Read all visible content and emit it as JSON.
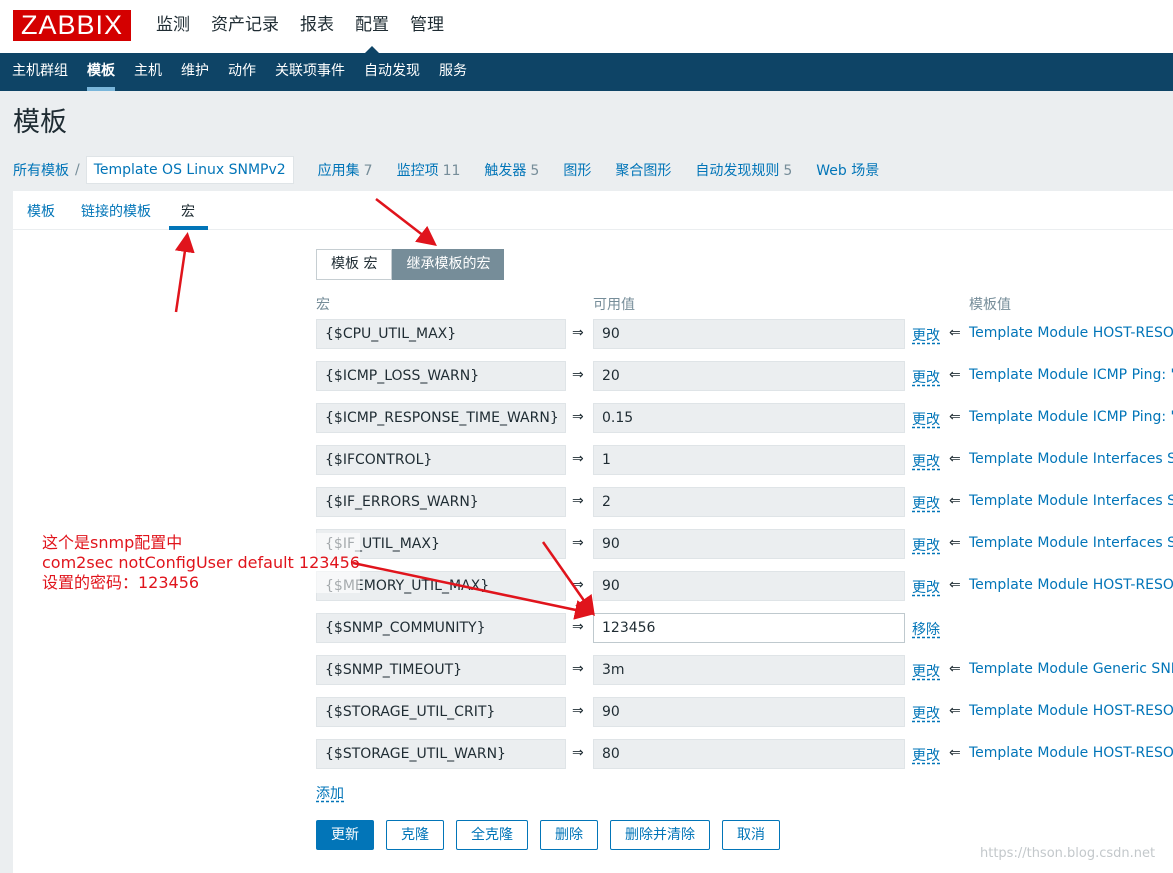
{
  "logo": "ZABBIX",
  "top_nav": [
    {
      "label": "监测",
      "active": false
    },
    {
      "label": "资产记录",
      "active": false
    },
    {
      "label": "报表",
      "active": false
    },
    {
      "label": "配置",
      "active": true
    },
    {
      "label": "管理",
      "active": false
    }
  ],
  "sub_nav": [
    {
      "label": "主机群组",
      "active": false
    },
    {
      "label": "模板",
      "active": true
    },
    {
      "label": "主机",
      "active": false
    },
    {
      "label": "维护",
      "active": false
    },
    {
      "label": "动作",
      "active": false
    },
    {
      "label": "关联项事件",
      "active": false
    },
    {
      "label": "自动发现",
      "active": false
    },
    {
      "label": "服务",
      "active": false
    }
  ],
  "page_title": "模板",
  "breadcrumb": {
    "all": "所有模板",
    "sep": "/",
    "current": "Template OS Linux SNMPv2",
    "links": [
      {
        "label": "应用集",
        "count": "7"
      },
      {
        "label": "监控项",
        "count": "11"
      },
      {
        "label": "触发器",
        "count": "5"
      },
      {
        "label": "图形",
        "count": ""
      },
      {
        "label": "聚合图形",
        "count": ""
      },
      {
        "label": "自动发现规则",
        "count": "5"
      },
      {
        "label": "Web 场景",
        "count": ""
      }
    ]
  },
  "tabs": [
    "模板",
    "链接的模板",
    "宏"
  ],
  "segment": {
    "template_macros": "模板 宏",
    "inherited_macros": "继承模板的宏"
  },
  "headers": {
    "macro": "宏",
    "effective_value": "可用值",
    "template_value": "模板值"
  },
  "rows": [
    {
      "macro": "{$CPU_UTIL_MAX}",
      "value": "90",
      "action": "更改",
      "template": "Template Module HOST-RESO"
    },
    {
      "macro": "{$ICMP_LOSS_WARN}",
      "value": "20",
      "action": "更改",
      "template": "Template Module ICMP Ping: \""
    },
    {
      "macro": "{$ICMP_RESPONSE_TIME_WARN}",
      "value": "0.15",
      "action": "更改",
      "template": "Template Module ICMP Ping: \""
    },
    {
      "macro": "{$IFCONTROL}",
      "value": "1",
      "action": "更改",
      "template": "Template Module Interfaces SN"
    },
    {
      "macro": "{$IF_ERRORS_WARN}",
      "value": "2",
      "action": "更改",
      "template": "Template Module Interfaces SN"
    },
    {
      "macro": "{$IF_UTIL_MAX}",
      "value": "90",
      "action": "更改",
      "template": "Template Module Interfaces SN"
    },
    {
      "macro": "{$MEMORY_UTIL_MAX}",
      "value": "90",
      "action": "更改",
      "template": "Template Module HOST-RESO"
    },
    {
      "macro": "{$SNMP_COMMUNITY}",
      "value": "123456",
      "action": "移除",
      "template": ""
    },
    {
      "macro": "{$SNMP_TIMEOUT}",
      "value": "3m",
      "action": "更改",
      "template": "Template Module Generic SNM"
    },
    {
      "macro": "{$STORAGE_UTIL_CRIT}",
      "value": "90",
      "action": "更改",
      "template": "Template Module HOST-RESO"
    },
    {
      "macro": "{$STORAGE_UTIL_WARN}",
      "value": "80",
      "action": "更改",
      "template": "Template Module HOST-RESO"
    }
  ],
  "arrow_right": "⇒",
  "arrow_left": "⇐",
  "add_link": "添加",
  "buttons": [
    "更新",
    "克隆",
    "全克隆",
    "删除",
    "删除并清除",
    "取消"
  ],
  "annotation": {
    "line1": "这个是snmp配置中",
    "line2": "com2sec notConfigUser default 123456",
    "line3": "设置的密码：123456"
  },
  "watermark": "https://thson.blog.csdn.net",
  "colors": {
    "brand": "#d40000",
    "nav": "#0e4466",
    "link": "#0275b8",
    "annotation": "#e0141c"
  }
}
